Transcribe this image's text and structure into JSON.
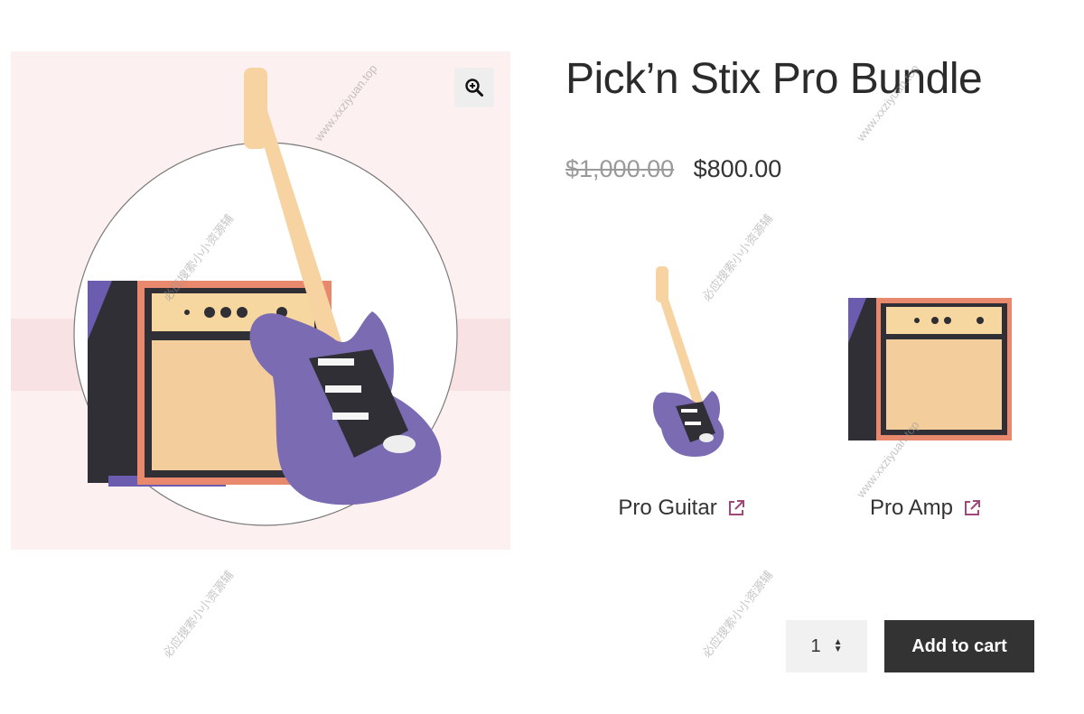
{
  "product": {
    "title": "Pick’n Stix Pro Bundle",
    "regular_price": "$1,000.00",
    "sale_price": "$800.00"
  },
  "gallery": {
    "main_image": "guitar-and-amp-illustration",
    "zoom_icon": "zoom-in-icon"
  },
  "bundle_items": [
    {
      "name": "Pro Guitar",
      "image": "guitar-illustration",
      "link_icon": "external-link-icon"
    },
    {
      "name": "Pro Amp",
      "image": "amp-illustration",
      "link_icon": "external-link-icon"
    }
  ],
  "cart": {
    "quantity": "1",
    "add_to_cart_label": "Add to cart"
  },
  "watermarks": {
    "url": "www.xxziyuan.top",
    "cn": "必应搜索小小资源辅"
  },
  "colors": {
    "accent_link": "#a0487a",
    "button_bg": "#333333",
    "guitar_body": "#7b6bb3",
    "amp_frame": "#e88a6e"
  }
}
